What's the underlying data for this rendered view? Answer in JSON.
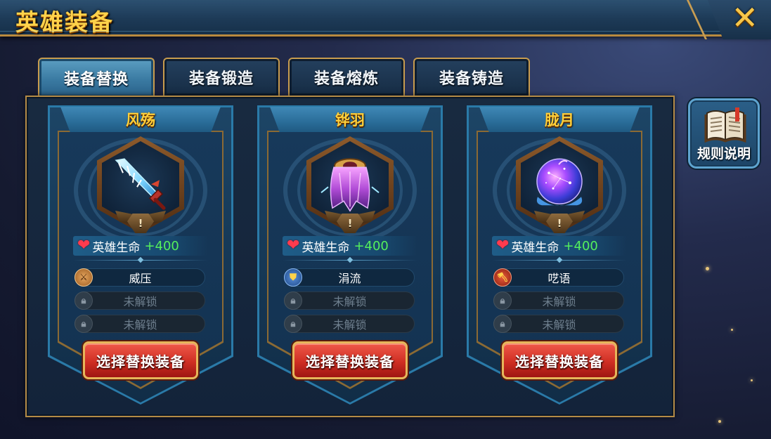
{
  "window": {
    "title": "英雄装备",
    "close_glyph": "✕"
  },
  "tabs": [
    {
      "label": "装备替换",
      "active": true
    },
    {
      "label": "装备锻造",
      "active": false
    },
    {
      "label": "装备熔炼",
      "active": false
    },
    {
      "label": "装备铸造",
      "active": false
    }
  ],
  "rules_button": {
    "label": "规则说明",
    "icon": "book-icon"
  },
  "cards": [
    {
      "name": "风殇",
      "item_icon": "crystal-sword-icon",
      "badge": "!",
      "stat": {
        "icon": "heart-icon",
        "label": "英雄生命",
        "value": "+400"
      },
      "skills": [
        {
          "name": "威压",
          "state": "unlocked",
          "icon": "sword-skill-icon"
        },
        {
          "name": "未解锁",
          "state": "locked",
          "icon": "lock-icon"
        },
        {
          "name": "未解锁",
          "state": "locked",
          "icon": "lock-icon"
        }
      ],
      "button": "选择替换装备"
    },
    {
      "name": "铧羽",
      "item_icon": "purple-cloak-icon",
      "badge": "!",
      "stat": {
        "icon": "heart-icon",
        "label": "英雄生命",
        "value": "+400"
      },
      "skills": [
        {
          "name": "涓流",
          "state": "unlocked",
          "icon": "shield-skill-icon"
        },
        {
          "name": "未解锁",
          "state": "locked",
          "icon": "lock-icon"
        },
        {
          "name": "未解锁",
          "state": "locked",
          "icon": "lock-icon"
        }
      ],
      "button": "选择替换装备"
    },
    {
      "name": "胧月",
      "item_icon": "starry-orb-icon",
      "badge": "!",
      "stat": {
        "icon": "heart-icon",
        "label": "英雄生命",
        "value": "+400"
      },
      "skills": [
        {
          "name": "呓语",
          "state": "unlocked",
          "icon": "axe-skill-icon"
        },
        {
          "name": "未解锁",
          "state": "locked",
          "icon": "lock-icon"
        },
        {
          "name": "未解锁",
          "state": "locked",
          "icon": "lock-icon"
        }
      ],
      "button": "选择替换装备"
    }
  ],
  "colors": {
    "title_gold": "#ffd24a",
    "card_name_gold": "#ffcf3a",
    "stat_green": "#54ef5c",
    "heart_red": "#ff3b4e",
    "button_red": "#cf2e23"
  }
}
